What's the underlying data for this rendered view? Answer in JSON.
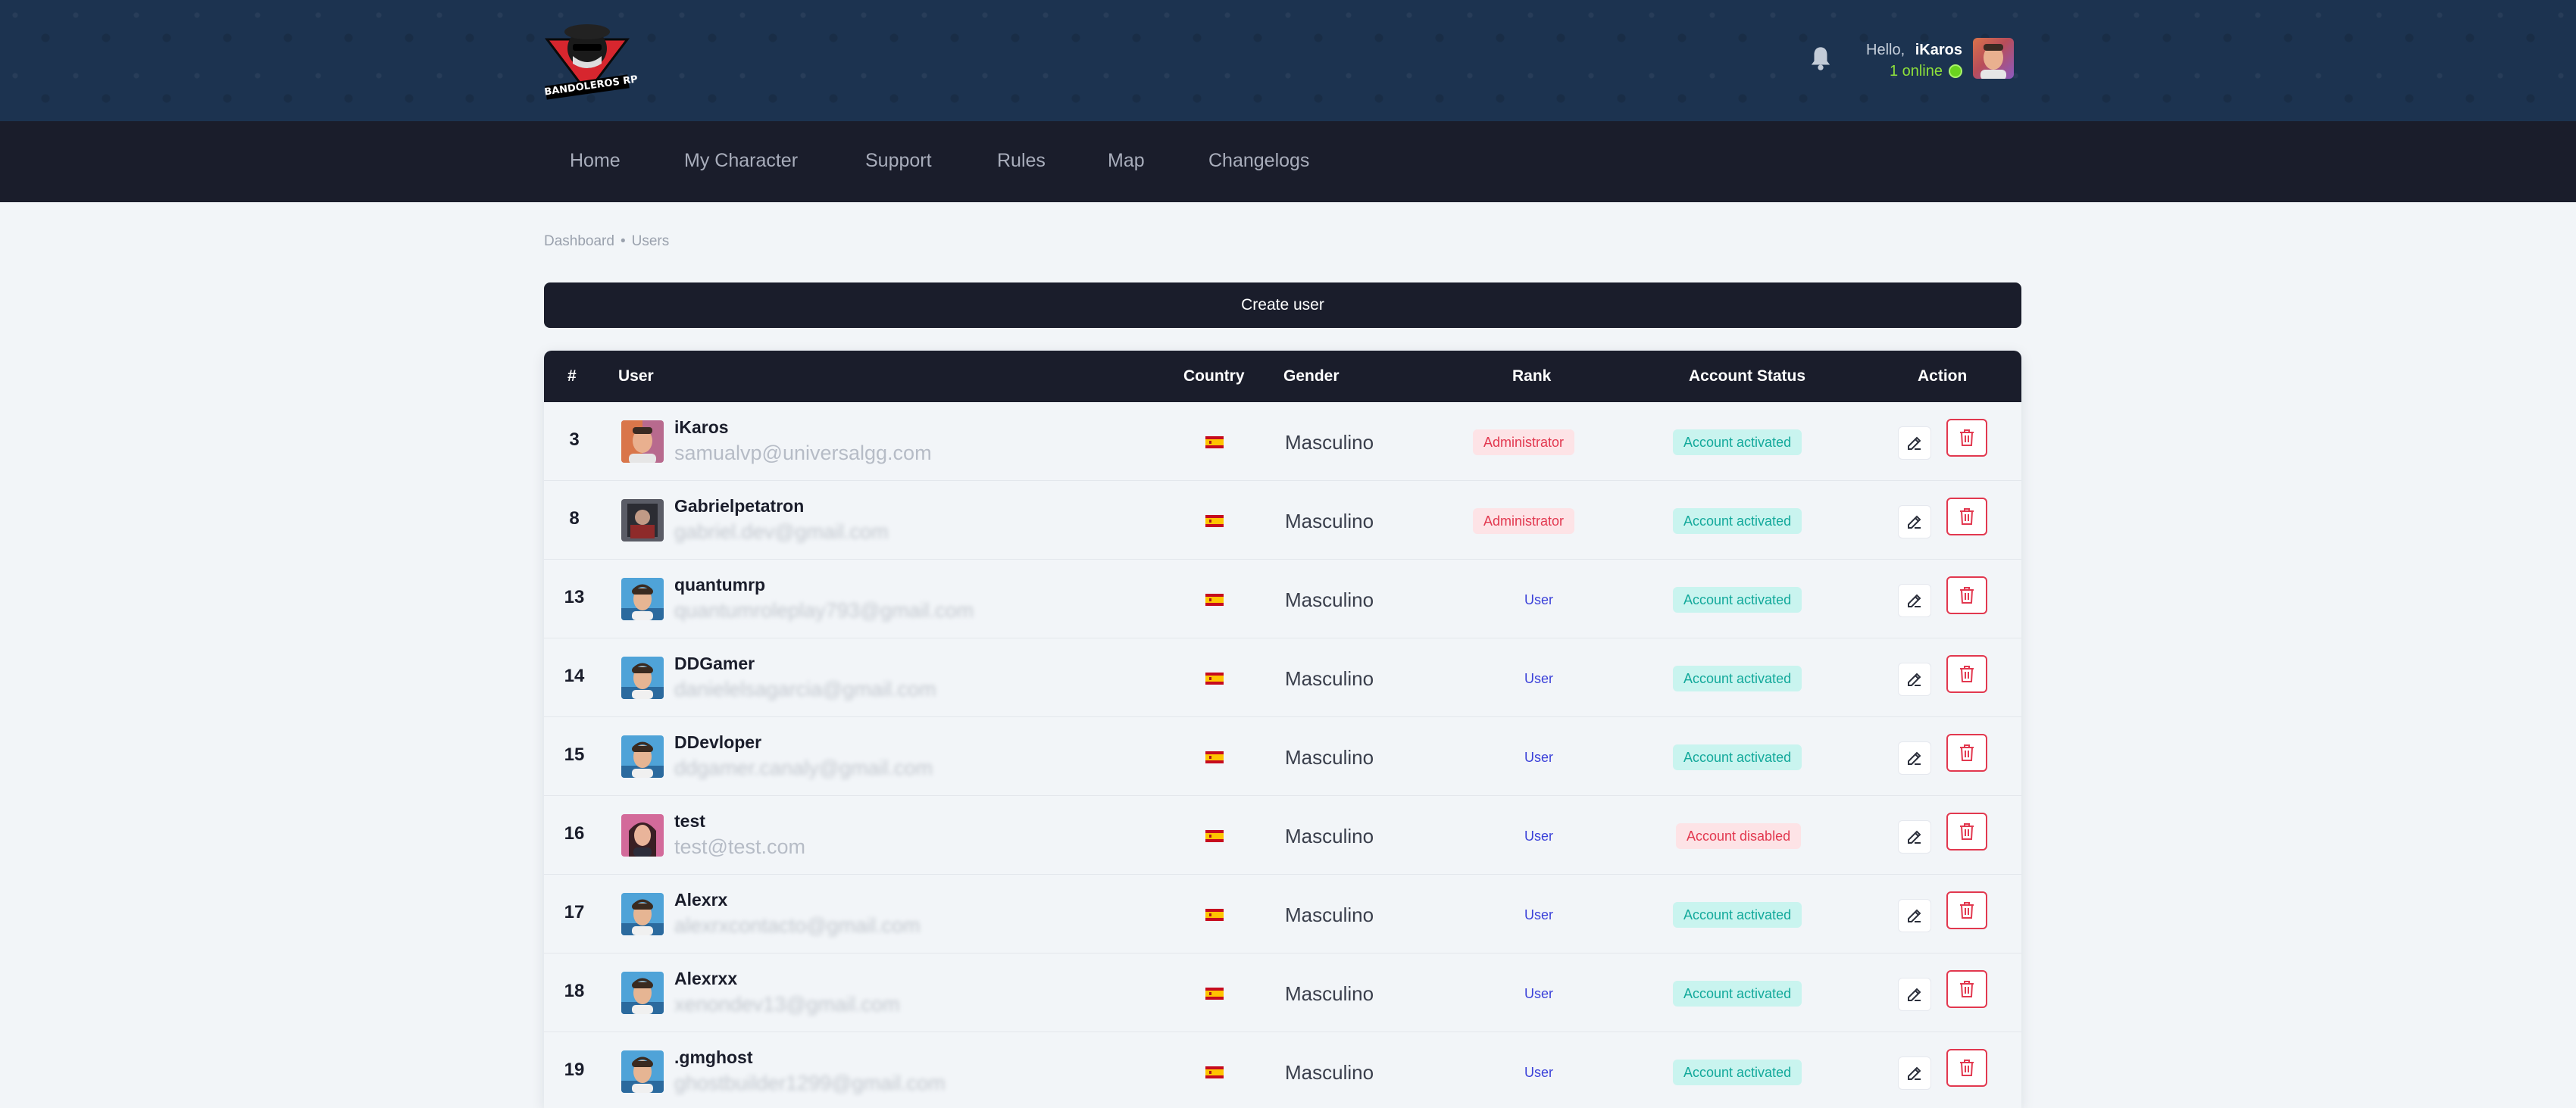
{
  "header": {
    "logo_text": "BANDOLEROS RP",
    "hello_label": "Hello,",
    "user_name": "iKaros",
    "online_text": "1 online"
  },
  "nav": {
    "items": [
      {
        "label": "Home"
      },
      {
        "label": "My Character"
      },
      {
        "label": "Support"
      },
      {
        "label": "Rules"
      },
      {
        "label": "Map"
      },
      {
        "label": "Changelogs"
      }
    ]
  },
  "breadcrumb": {
    "parent": "Dashboard",
    "separator": "•",
    "current": "Users"
  },
  "create_button": "Create user",
  "table": {
    "headers": {
      "num": "#",
      "user": "User",
      "country": "Country",
      "gender": "Gender",
      "rank": "Rank",
      "status": "Account Status",
      "action": "Action"
    },
    "rows": [
      {
        "id": "3",
        "name": "iKaros",
        "email": "samualvp@universalgg.com",
        "email_blurred": false,
        "gender": "Masculino",
        "rank": "Administrator",
        "rank_type": "admin",
        "status": "Account activated",
        "status_type": "active",
        "avatar": "ikaros"
      },
      {
        "id": "8",
        "name": "Gabrielpetatron",
        "email": "gabriel.dev@gmail.com",
        "email_blurred": true,
        "gender": "Masculino",
        "rank": "Administrator",
        "rank_type": "admin",
        "status": "Account activated",
        "status_type": "active",
        "avatar": "dark"
      },
      {
        "id": "13",
        "name": "quantumrp",
        "email": "quantumroleplay793@gmail.com",
        "email_blurred": true,
        "gender": "Masculino",
        "rank": "User",
        "rank_type": "user",
        "status": "Account activated",
        "status_type": "active",
        "avatar": "male"
      },
      {
        "id": "14",
        "name": "DDGamer",
        "email": "danielelsagarcia@gmail.com",
        "email_blurred": true,
        "gender": "Masculino",
        "rank": "User",
        "rank_type": "user",
        "status": "Account activated",
        "status_type": "active",
        "avatar": "male"
      },
      {
        "id": "15",
        "name": "DDevloper",
        "email": "ddgamer.canaly@gmail.com",
        "email_blurred": true,
        "gender": "Masculino",
        "rank": "User",
        "rank_type": "user",
        "status": "Account activated",
        "status_type": "active",
        "avatar": "male"
      },
      {
        "id": "16",
        "name": "test",
        "email": "test@test.com",
        "email_blurred": false,
        "gender": "Masculino",
        "rank": "User",
        "rank_type": "user",
        "status": "Account disabled",
        "status_type": "disabled",
        "avatar": "female"
      },
      {
        "id": "17",
        "name": "Alexrx",
        "email": "alexrxcontacto@gmail.com",
        "email_blurred": true,
        "gender": "Masculino",
        "rank": "User",
        "rank_type": "user",
        "status": "Account activated",
        "status_type": "active",
        "avatar": "male"
      },
      {
        "id": "18",
        "name": "Alexrxx",
        "email": "xenondev13@gmail.com",
        "email_blurred": true,
        "gender": "Masculino",
        "rank": "User",
        "rank_type": "user",
        "status": "Account activated",
        "status_type": "active",
        "avatar": "male"
      },
      {
        "id": "19",
        "name": ".gmghost",
        "email": "ghostbuilder1299@gmail.com",
        "email_blurred": true,
        "gender": "Masculino",
        "rank": "User",
        "rank_type": "user",
        "status": "Account activated",
        "status_type": "active",
        "avatar": "male"
      }
    ]
  },
  "colors": {
    "header_bg": "#1c3350",
    "nav_bg": "#1a1d2b",
    "admin_badge": "#e2384f",
    "user_badge": "#3b41d9",
    "active_badge": "#13a99b",
    "online": "#8ee03b"
  },
  "icons": {
    "bell": "bell-icon",
    "edit": "edit-icon",
    "delete": "trash-icon",
    "flag": "spain-flag-icon"
  }
}
